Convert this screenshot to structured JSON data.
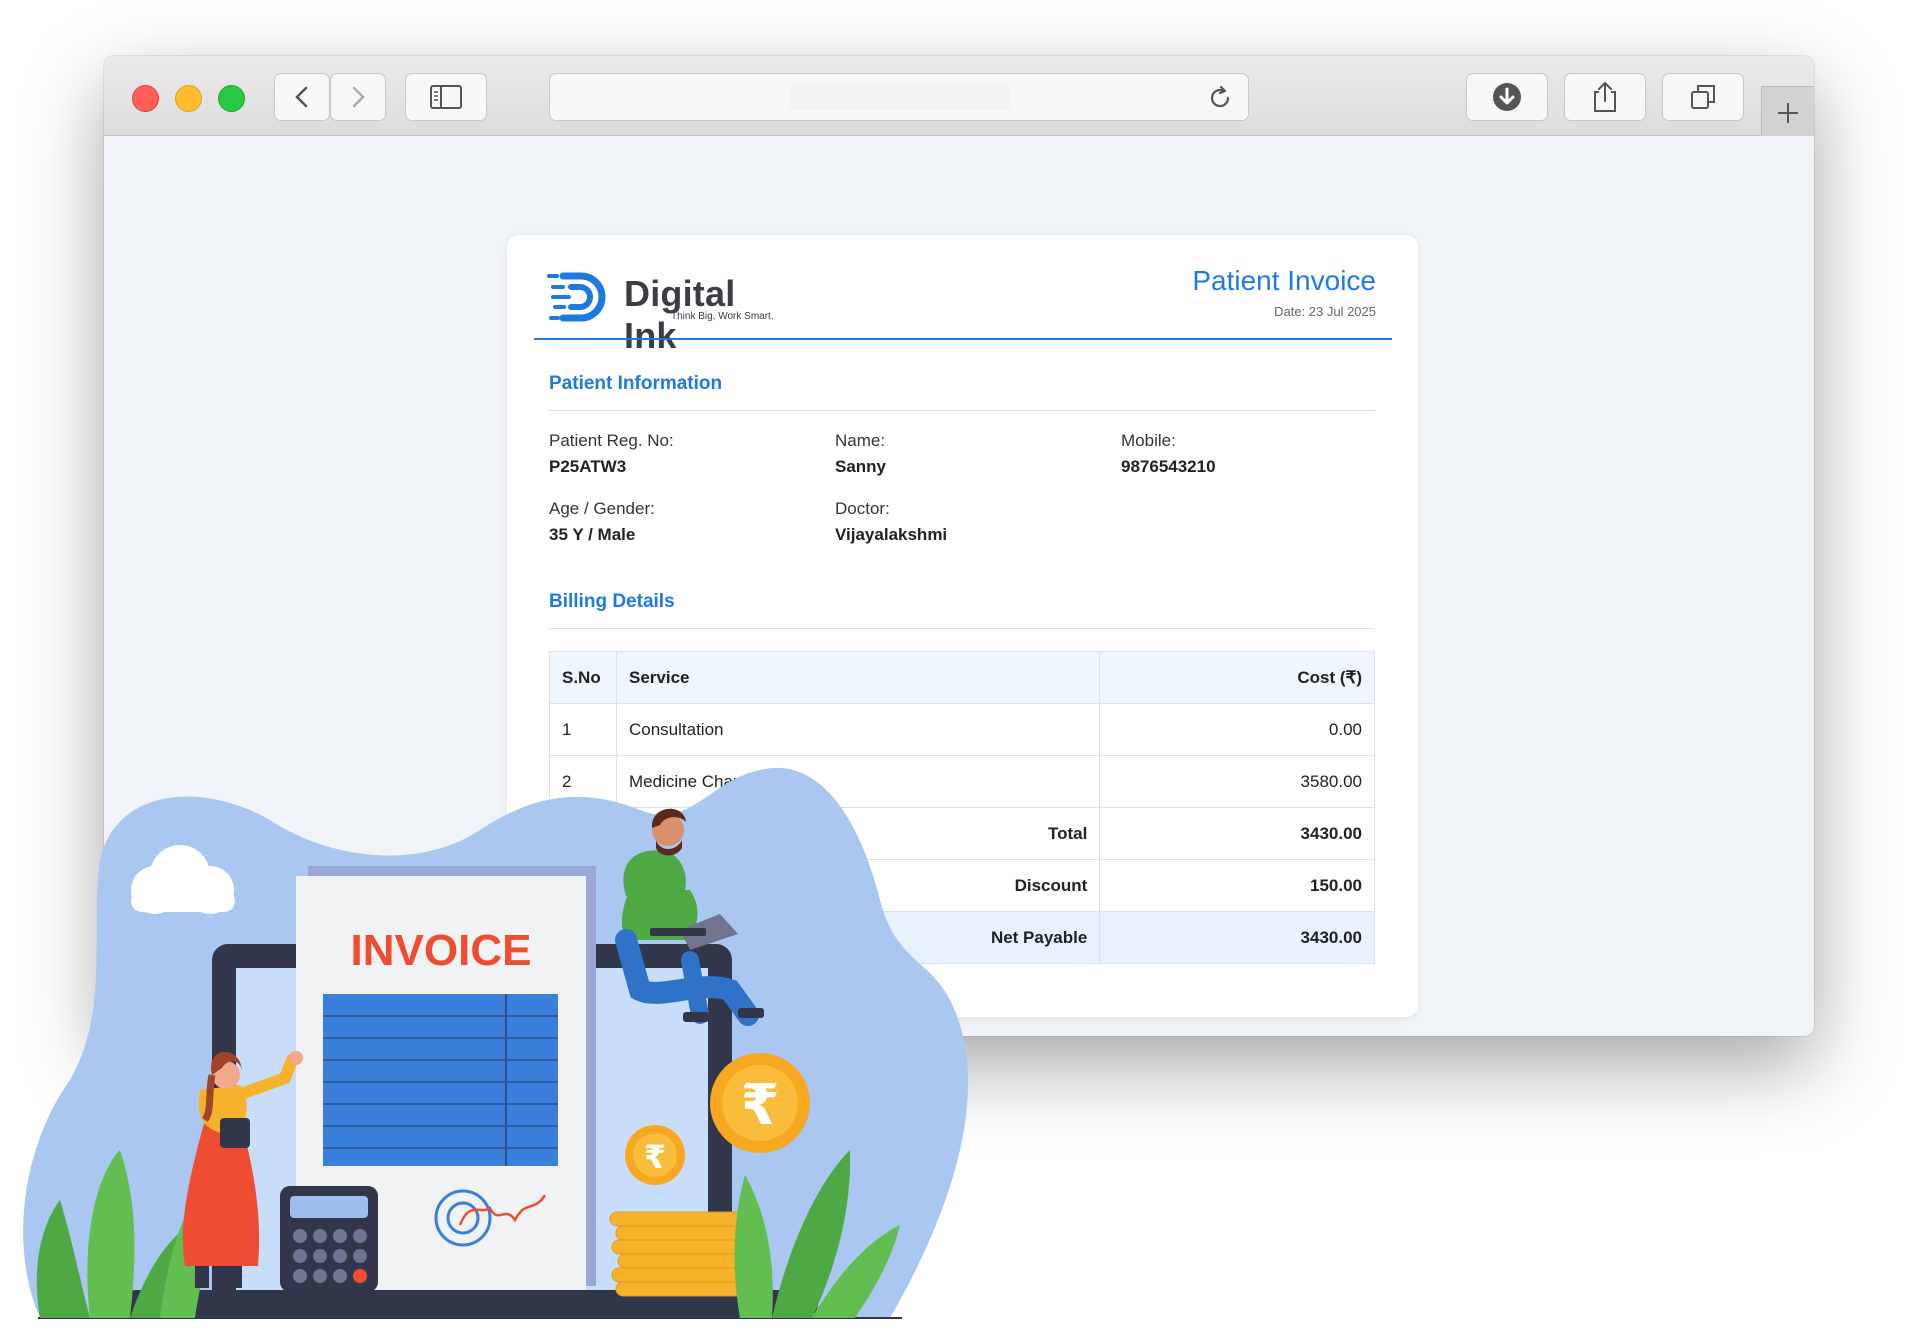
{
  "header": {
    "logo_name": "Digital Ink",
    "logo_tagline": "Think Big, Work Smart.",
    "title": "Patient Invoice",
    "date": "Date: 23 Jul 2025"
  },
  "patient": {
    "section_title": "Patient Information",
    "fields": [
      {
        "label": "Patient Reg. No:",
        "value": "P25ATW3"
      },
      {
        "label": "Name:",
        "value": "Sanny"
      },
      {
        "label": "Mobile:",
        "value": "9876543210"
      },
      {
        "label": "Age / Gender:",
        "value": "35 Y / Male"
      },
      {
        "label": "Doctor:",
        "value": "Vijayalakshmi"
      }
    ]
  },
  "billing": {
    "section_title": "Billing Details",
    "columns": [
      "S.No",
      "Service",
      "Cost (₹)"
    ],
    "rows": [
      {
        "sno": "1",
        "service": "Consultation",
        "cost": "0.00"
      },
      {
        "sno": "2",
        "service": "Medicine Charges",
        "cost": "3580.00"
      }
    ],
    "total_label": "Total",
    "total_value": "3430.00",
    "discount_label": "Discount",
    "discount_value": "150.00",
    "net_label": "Net Payable",
    "net_value": "3430.00"
  },
  "illustration": {
    "invoice_heading": "INVOICE",
    "currency_symbol": "₹"
  },
  "colors": {
    "accent": "#1f7ae0",
    "net_row_bg": "#e8f2fd",
    "header_row_bg": "#eff5fc"
  }
}
